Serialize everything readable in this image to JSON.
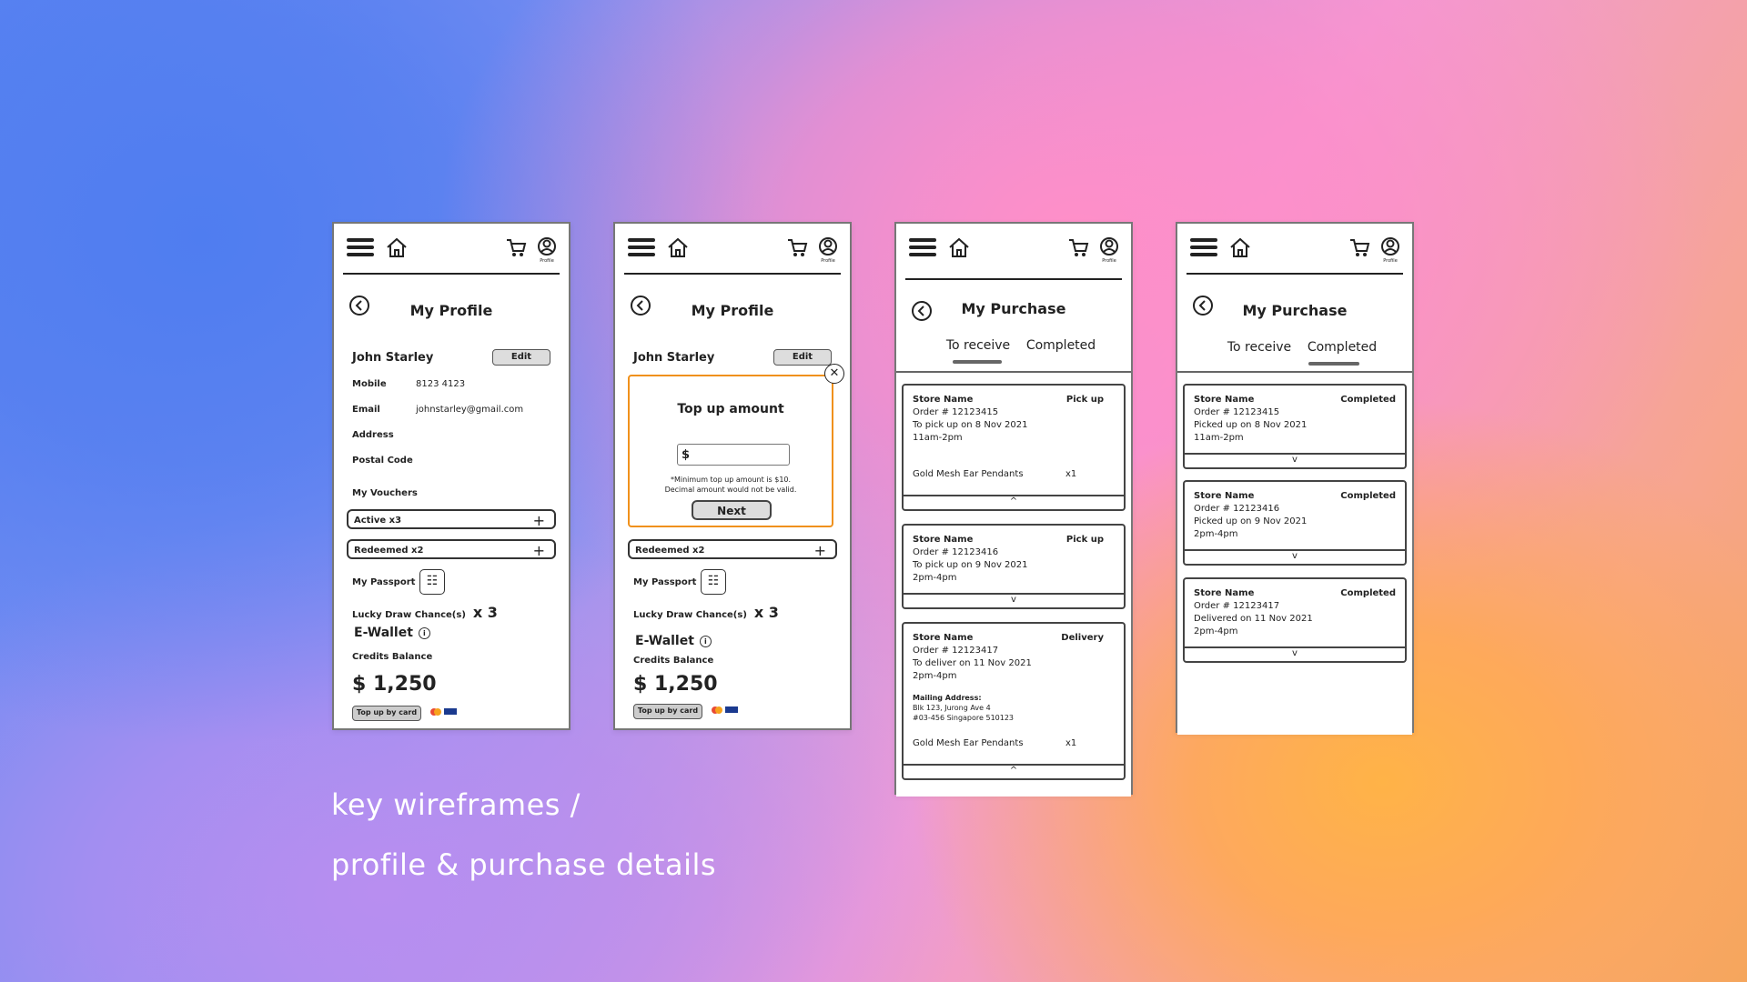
{
  "nav": {
    "profile_label": "Profile"
  },
  "profile": {
    "title": "My Profile",
    "name": "John Starley",
    "edit_label": "Edit",
    "fields": [
      {
        "label": "Mobile",
        "value": "8123 4123"
      },
      {
        "label": "Email",
        "value": "johnstarley@gmail.com"
      },
      {
        "label": "Address",
        "value": ""
      },
      {
        "label": "Postal Code",
        "value": ""
      }
    ],
    "vouchers_label": "My Vouchers",
    "vouchers": [
      {
        "label": "Active x3"
      },
      {
        "label": "Redeemed x2"
      }
    ],
    "passport_label": "My Passport",
    "lucky_label": "Lucky Draw Chance(s)",
    "lucky_count": "x 3",
    "ewallet_label": "E-Wallet",
    "credits_label": "Credits Balance",
    "balance": "$ 1,250",
    "topup_label": "Top up by card"
  },
  "topup_popup": {
    "title": "Top up amount",
    "currency": "$",
    "note_line1": "*Minimum top up amount is $10.",
    "note_line2": "Decimal amount would not be valid.",
    "next_label": "Next"
  },
  "purchase": {
    "title": "My Purchase",
    "tabs": [
      "To receive",
      "Completed"
    ],
    "to_receive": [
      {
        "store": "Store Name",
        "status": "Pick up",
        "order": "Order # 12123415",
        "line2": "To pick up on 8 Nov 2021",
        "line3": "11am-2pm",
        "item": "Gold Mesh Ear Pendants",
        "qty": "x1",
        "toggle": "^"
      },
      {
        "store": "Store Name",
        "status": "Pick up",
        "order": "Order # 12123416",
        "line2": "To pick up on 9 Nov 2021",
        "line3": "2pm-4pm",
        "toggle": "v"
      },
      {
        "store": "Store Name",
        "status": "Delivery",
        "order": "Order # 12123417",
        "line2": "To deliver on 11 Nov 2021",
        "line3": "2pm-4pm",
        "mail_label": "Mailing Address:",
        "mail1": "Blk 123, Jurong Ave 4",
        "mail2": "#03-456 Singapore 510123",
        "item": "Gold Mesh Ear Pendants",
        "qty": "x1",
        "toggle": "^"
      }
    ],
    "completed": [
      {
        "store": "Store Name",
        "status": "Completed",
        "order": "Order # 12123415",
        "line2": "Picked up on 8 Nov 2021",
        "line3": "11am-2pm",
        "toggle": "v"
      },
      {
        "store": "Store Name",
        "status": "Completed",
        "order": "Order # 12123416",
        "line2": "Picked up on 9 Nov 2021",
        "line3": "2pm-4pm",
        "toggle": "v"
      },
      {
        "store": "Store Name",
        "status": "Completed",
        "order": "Order # 12123417",
        "line2": "Delivered on 11 Nov 2021",
        "line3": "2pm-4pm",
        "toggle": "v"
      }
    ]
  },
  "caption": {
    "line1": "key wireframes /",
    "line2": "profile & purchase details"
  }
}
